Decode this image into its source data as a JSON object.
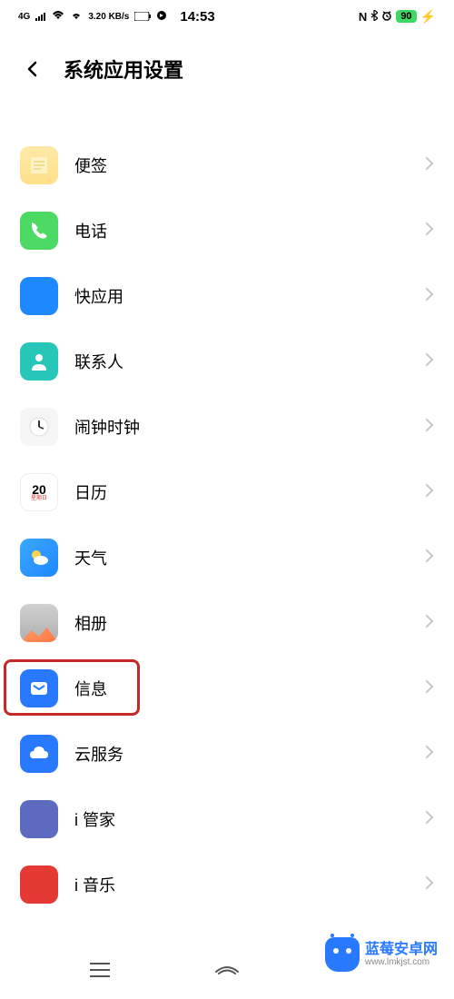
{
  "status_bar": {
    "signal_label": "4G",
    "net_speed": "3.20 KB/s",
    "time": "14:53",
    "nfc": "N",
    "battery_percent": "90"
  },
  "header": {
    "title": "系统应用设置"
  },
  "apps": [
    {
      "id": "notes",
      "label": "便签",
      "icon_class": "icon-notes"
    },
    {
      "id": "phone",
      "label": "电话",
      "icon_class": "icon-phone"
    },
    {
      "id": "quickapp",
      "label": "快应用",
      "icon_class": "icon-quick"
    },
    {
      "id": "contacts",
      "label": "联系人",
      "icon_class": "icon-contacts"
    },
    {
      "id": "clock",
      "label": "闹钟时钟",
      "icon_class": "icon-clock"
    },
    {
      "id": "calendar",
      "label": "日历",
      "icon_class": "icon-calendar",
      "cal_day": "20",
      "cal_sub": "星期日"
    },
    {
      "id": "weather",
      "label": "天气",
      "icon_class": "icon-weather"
    },
    {
      "id": "gallery",
      "label": "相册",
      "icon_class": "icon-gallery"
    },
    {
      "id": "messages",
      "label": "信息",
      "icon_class": "icon-messages",
      "highlighted": true
    },
    {
      "id": "cloud",
      "label": "云服务",
      "icon_class": "icon-cloud"
    },
    {
      "id": "imanager",
      "label": "i 管家",
      "icon_class": "icon-manager"
    },
    {
      "id": "imusic",
      "label": "i 音乐",
      "icon_class": "icon-music"
    }
  ],
  "watermark": {
    "title": "蓝莓安卓网",
    "url": "www.lmkjst.com"
  }
}
